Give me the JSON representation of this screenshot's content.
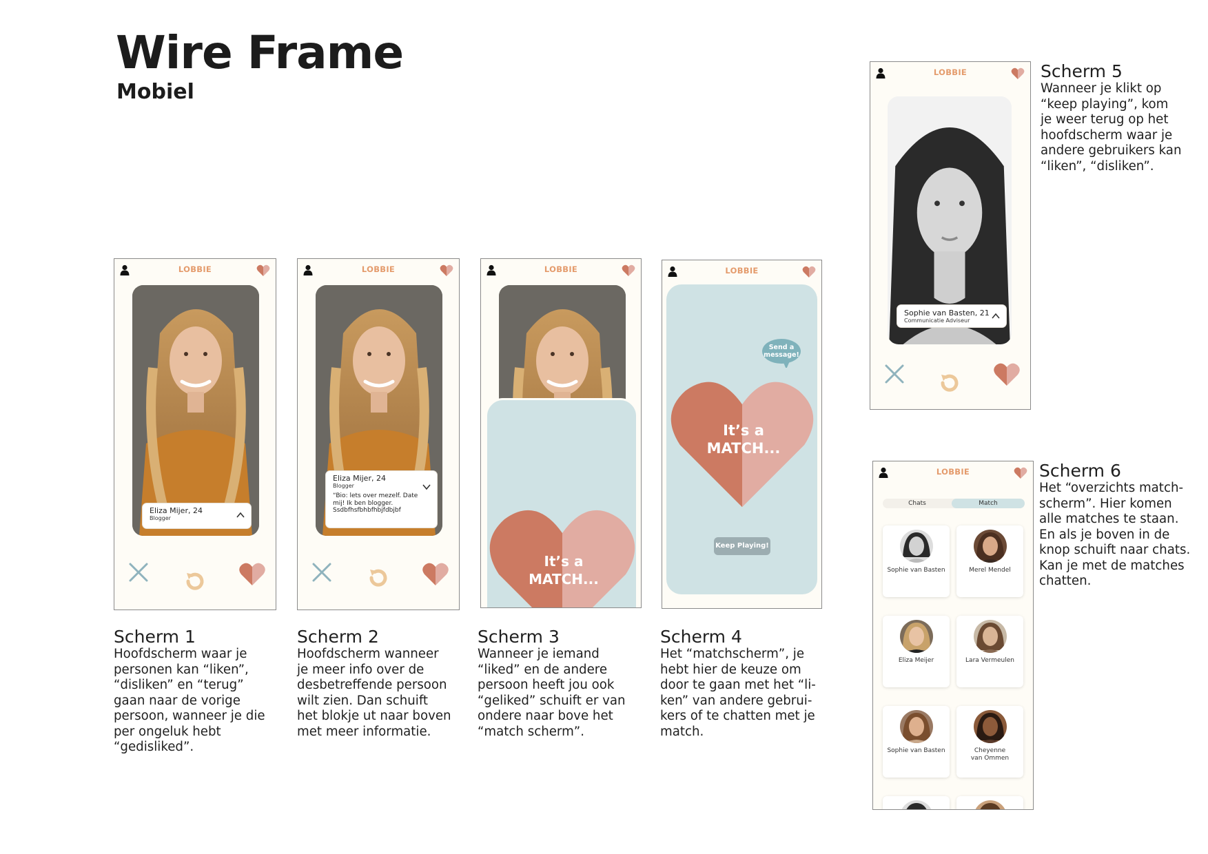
{
  "page": {
    "title": "Wire Frame",
    "subtitle": "Mobiel"
  },
  "app": {
    "logo": "LOBBIE"
  },
  "colors": {
    "accent": "#e49b6c",
    "heart_dark": "#cc7a62",
    "heart_light": "#e1aca2",
    "match_bg": "#cfe2e4",
    "dislike": "#8fb3bd",
    "undo": "#ecc89a"
  },
  "icons": [
    "user-icon",
    "heart-icon",
    "dislike-x-icon",
    "undo-icon",
    "like-heart-icon",
    "chevron-up-icon",
    "chevron-down-icon",
    "speech-bubble-icon"
  ],
  "screens": [
    {
      "heading": "Scherm 1",
      "description": "Hoofdscherm waar je\npersonen kan “liken”,\n“disliken” en “terug”\ngaan naar de vorige\npersoon, wanneer je die\nper ongeluk hebt\n“gedisliked”.",
      "profile": {
        "name": "Eliza Mijer, 24",
        "role": "Blogger"
      }
    },
    {
      "heading": "Scherm 2",
      "description": "Hoofdscherm wanneer\nje meer info over de\ndesbetreffende persoon\nwilt zien. Dan schuift\nhet blokje ut naar boven\nmet meer informatie.",
      "profile": {
        "name": "Eliza Mijer, 24",
        "role": "Blogger",
        "bio": "“Bio: lets over mezelf. Date\nmij! Ik ben blogger.\nSsdbfhsfbhbfhbjfdbjbf"
      }
    },
    {
      "heading": "Scherm 3",
      "description": "Wanneer je iemand\n“liked” en de andere\npersoon heeft jou ook\n“geliked” schuift er van\nondere naar bove het\n“match scherm”.",
      "match_text": "It’s a\nMATCH..."
    },
    {
      "heading": "Scherm 4",
      "description": "Het “matchscherm”, je\nhebt hier de keuze om\ndoor te gaan met het “li-\nken” van andere gebrui-\nkers of te chatten met je\nmatch.",
      "match_text": "It’s a\nMATCH...",
      "send_message": "Send a\nmessage!",
      "keep_playing": "Keep Playing!"
    },
    {
      "heading": "Scherm 5",
      "description": "Wanneer je klikt op\n“keep playing”, kom\nje weer terug op het\nhoofdscherm waar je\nandere gebruikers kan\n“liken”, “disliken”.",
      "profile": {
        "name": "Sophie van Basten, 21",
        "role": "Communicatie Adviseur"
      }
    },
    {
      "heading": "Scherm 6",
      "description": "Het “overzichts match-\nscherm”. Hier komen\nalle matches te staan.\nEn als je boven in de\nknop schuift naar chats.\nKan je met de matches\nchatten.",
      "tabs": [
        "Chats",
        "Match"
      ],
      "matches": [
        "Sophie van Basten",
        "Merel Mendel",
        "Eliza Meijer",
        "Lara Vermeulen",
        "Sophie van Basten",
        "Cheyenne\nvan Ommen"
      ]
    }
  ]
}
